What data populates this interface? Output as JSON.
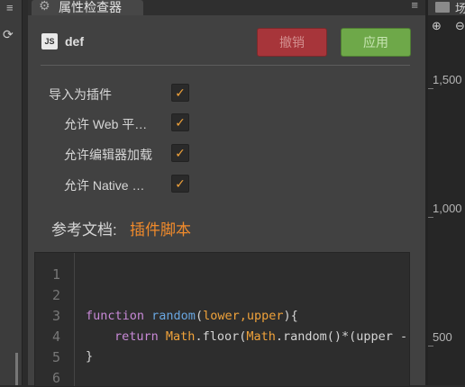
{
  "left_strip": {
    "menu_icon": "hamburger-icon",
    "refresh_icon": "refresh-icon"
  },
  "inspector": {
    "tab_title": "属性检查器",
    "tab_icon": "gear-icon",
    "asset_icon": "JS",
    "asset_name": "def",
    "revert_label": "撤销",
    "apply_label": "应用",
    "properties": [
      {
        "label": "导入为插件",
        "checked": true
      },
      {
        "label": "允许 Web 平…",
        "checked": true
      },
      {
        "label": "允许编辑器加载",
        "checked": true
      },
      {
        "label": "允许 Native …",
        "checked": true
      }
    ],
    "doc_label": "参考文档:",
    "doc_link": "插件脚本",
    "code": {
      "line_numbers": [
        "1",
        "2",
        "3",
        "4",
        "5",
        "6"
      ],
      "line3": {
        "kw": "function",
        "name": "random",
        "open": "(",
        "params": "lower,upper",
        "close": "){"
      },
      "line4": {
        "kw": "return",
        "obj1": "Math",
        "m1": ".floor(",
        "obj2": "Math",
        "m2": ".random()*(upper -"
      },
      "line5": "}"
    }
  },
  "scene": {
    "tab_text": "场",
    "ruler_labels": [
      "1,500",
      "1,000",
      "500"
    ]
  },
  "colors": {
    "accent_orange": "#f08a2b",
    "revert_red": "#a7353a",
    "apply_green": "#6ea849",
    "keyword": "#c889d7",
    "function_name": "#69a6e0"
  }
}
